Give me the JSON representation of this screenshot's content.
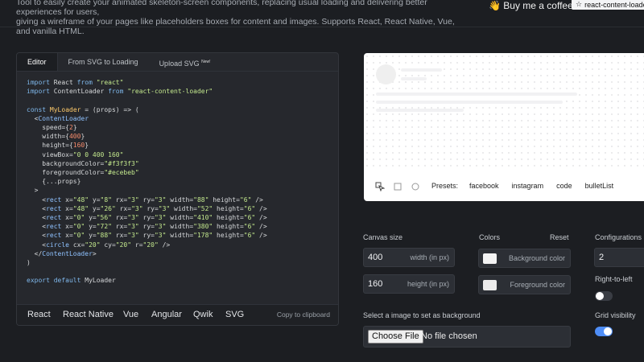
{
  "header": {
    "intro_line1": "Tool to easily create your animated skeleton-screen components, replacing usual loading and delivering better experiences for users,",
    "intro_line2": "giving a wireframe of your pages like placeholders boxes for content and images. Supports React, React Native, Vue, and vanilla HTML.",
    "coffee_label": "👋 Buy me a coffee",
    "star_label": "react-content-loader"
  },
  "editor": {
    "tabs": [
      {
        "label": "Editor",
        "active": true
      },
      {
        "label": "From SVG to Loading",
        "active": false
      },
      {
        "label": "Upload SVG",
        "badge": "New!",
        "active": false
      }
    ],
    "frameworks": [
      {
        "label": "React",
        "active": true
      },
      {
        "label": "React Native",
        "active": false
      },
      {
        "label": "Vue",
        "active": false
      },
      {
        "label": "Angular",
        "active": false
      },
      {
        "label": "Qwik",
        "active": false
      },
      {
        "label": "SVG",
        "active": false
      }
    ],
    "copy_label": "Copy to clipboard"
  },
  "preview": {
    "presets_label": "Presets:",
    "presets": [
      "facebook",
      "instagram",
      "code",
      "bulletList"
    ]
  },
  "settings": {
    "canvas_size_label": "Canvas size",
    "width_value": "400",
    "width_suffix": "width (in px)",
    "height_value": "160",
    "height_suffix": "height (in px)",
    "colors_label": "Colors",
    "reset_label": "Reset",
    "background_color_label": "Background color",
    "background_color": "#f3f3f3",
    "foreground_color_label": "Foreground color",
    "foreground_color": "#ecebeb",
    "configurations_label": "Configurations",
    "speed_value": "2",
    "rtl_label": "Right-to-left",
    "rtl_on": false,
    "grid_label": "Grid visibility",
    "grid_on": true,
    "bg_image_label": "Select a image to set as background",
    "choose_file_label": "Choose File",
    "no_file_label": "No file chosen",
    "accent_color": "#4f8ef7"
  }
}
